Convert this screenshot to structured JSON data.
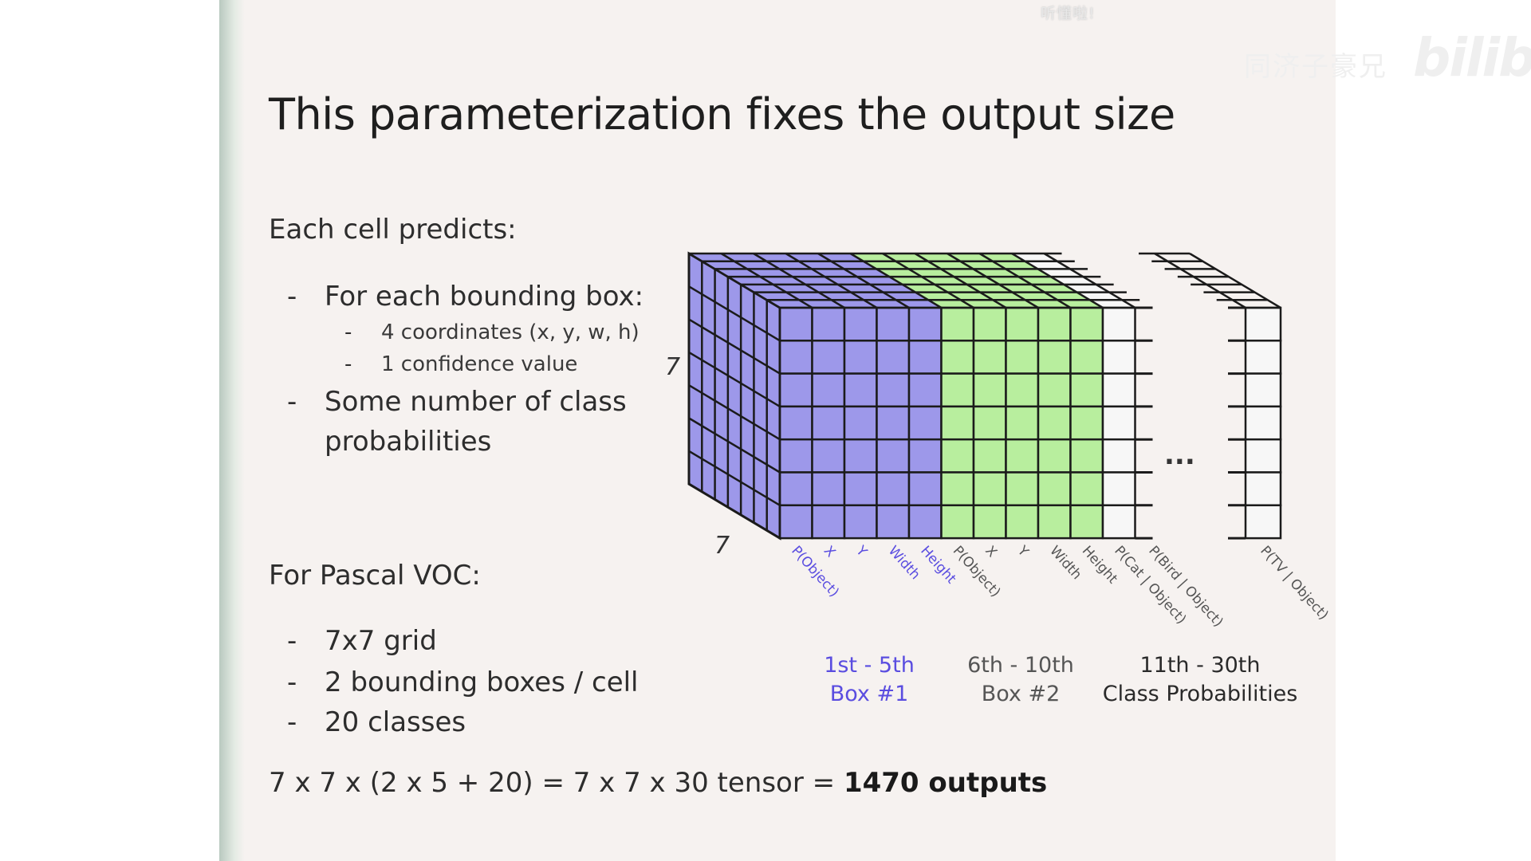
{
  "watermark": {
    "top": "听懂啦!",
    "right": "同济子豪兄",
    "logo": "bilibili"
  },
  "slide": {
    "title": "This parameterization fixes the output size",
    "each_cell_heading": "Each cell predicts:",
    "each_cell_items": [
      "For each bounding box:",
      "Some number of class",
      "probabilities"
    ],
    "bbox_subitems": [
      "4 coordinates (x, y, w, h)",
      "1 confidence value"
    ],
    "pascal_heading": "For Pascal VOC:",
    "pascal_items": [
      "7x7 grid",
      "2 bounding boxes / cell",
      "20 classes"
    ],
    "formula_text": "7 x 7 x (2 x 5 + 20) = 7 x 7 x 30 tensor = ",
    "formula_bold": "1470 outputs",
    "dash": "-"
  },
  "diagram": {
    "grid_size": 7,
    "dim_height_label": "7",
    "dim_depth_label": "7",
    "ellipsis": "...",
    "channel_labels": [
      "P(Object)",
      "X",
      "Y",
      "Width",
      "Height",
      "P(Object)",
      "X",
      "Y",
      "Width",
      "Height",
      "P(Cat | Object)",
      "P(Bird | Object)",
      "P(TV | Object)"
    ],
    "groups": [
      {
        "line1": "1st - 5th",
        "line2": "Box #1",
        "color": "#5a4de0"
      },
      {
        "line1": "6th - 10th",
        "line2": "Box #2",
        "color": "#555555"
      },
      {
        "line1": "11th - 30th",
        "line2": "Class Probabilities",
        "color": "#2a2a2a"
      }
    ],
    "colors": {
      "box1": "#9d98ea",
      "box2": "#b8ee9e",
      "class": "#f7f7f7",
      "line": "#1b1b1b"
    }
  }
}
